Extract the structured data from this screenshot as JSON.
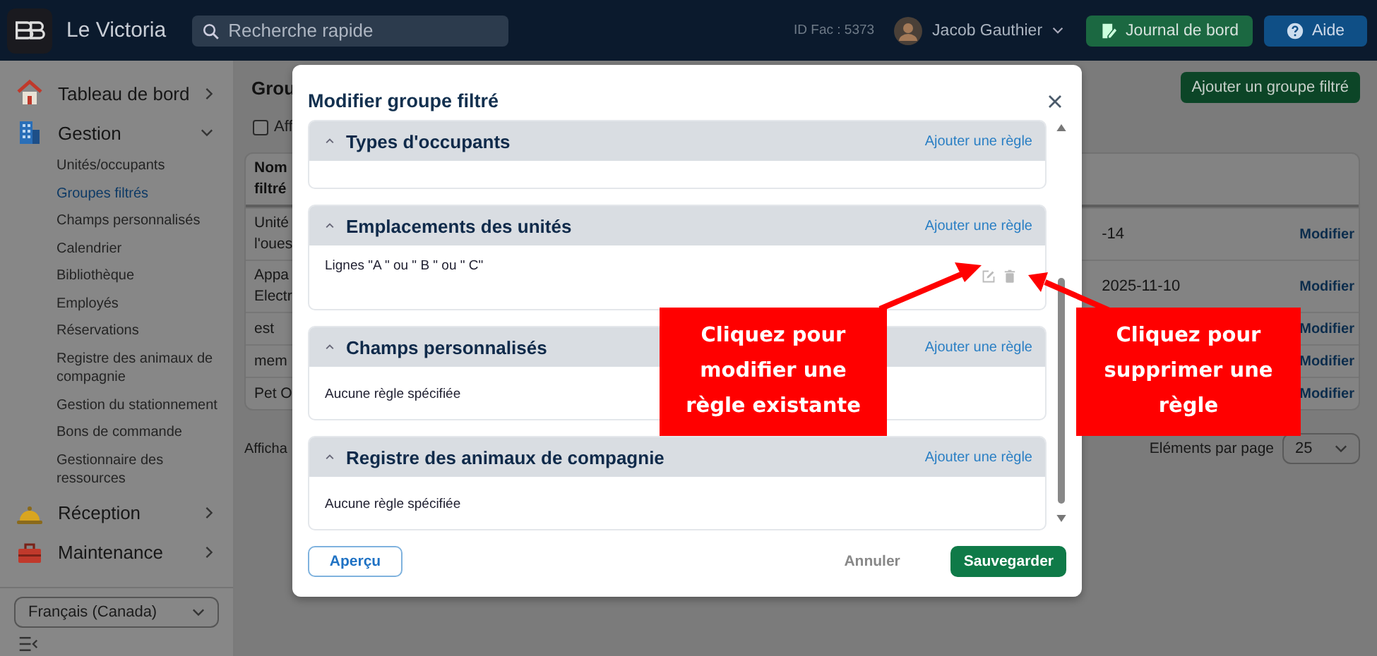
{
  "topbar": {
    "brand": "Le Victoria",
    "search": {
      "placeholder": "Recherche rapide"
    },
    "facility_id": "ID Fac : 5373",
    "user": "Jacob Gauthier",
    "buttons": [
      {
        "kind": "journal",
        "label": "Journal de bord"
      },
      {
        "kind": "help",
        "label": "Aide"
      }
    ]
  },
  "sidebar": {
    "items": [
      {
        "kind": "home",
        "label": "Tableau de bord",
        "expanded": false
      },
      {
        "kind": "building",
        "label": "Gestion",
        "expanded": true,
        "children": [
          {
            "label": "Unités/occupants",
            "selected": false
          },
          {
            "label": "Groupes filtrés",
            "selected": true
          },
          {
            "label": "Champs personnalisés",
            "selected": false
          },
          {
            "label": "Calendrier",
            "selected": false
          },
          {
            "label": "Bibliothèque",
            "selected": false
          },
          {
            "label": "Employés",
            "selected": false
          },
          {
            "label": "Réservations",
            "selected": false
          },
          {
            "label": "Registre des animaux de compagnie",
            "selected": false
          },
          {
            "label": "Gestion du stationnement",
            "selected": false
          },
          {
            "label": "Bons de commande",
            "selected": false
          },
          {
            "label": "Gestionnaire des ressources",
            "selected": false
          }
        ]
      },
      {
        "kind": "bell",
        "label": "Réception",
        "expanded": false
      },
      {
        "kind": "toolbox",
        "label": "Maintenance",
        "expanded": false
      }
    ],
    "language": "Français (Canada)"
  },
  "page": {
    "title": "Grou",
    "add_button": "Ajouter un groupe filtré",
    "checkbox": {
      "label": "Aff",
      "checked": false
    },
    "table": {
      "column_1": "Nom filtré",
      "rows": [
        {
          "column_1": "Unité l'oues",
          "column_2": "-14",
          "action": "Modifier"
        },
        {
          "column_1": "Appa Electr",
          "column_2": "2025-11-10",
          "action": "Modifier"
        },
        {
          "column_1": "est",
          "action": "Modifier"
        },
        {
          "column_1": "mem",
          "action": "Modifier"
        },
        {
          "column_1": "Pet O",
          "action": "Modifier"
        }
      ]
    },
    "footer_text": "Afficha",
    "page_size_label": "Eléments par page",
    "page_size": "25"
  },
  "modal": {
    "title": "Modifier groupe filtré",
    "sections": [
      {
        "title": "Types d'occupants",
        "expanded": true,
        "add_link": "Ajouter une règle"
      },
      {
        "title": "Emplacements des unités",
        "expanded": true,
        "add_link": "Ajouter une règle",
        "rules": [
          {
            "text": "Lignes \"A \" ou \" B \" ou \" C\""
          }
        ]
      },
      {
        "title": "Champs personnalisés",
        "expanded": true,
        "add_link": "Ajouter une règle",
        "empty_text": "Aucune règle spécifiée"
      },
      {
        "title": "Registre des animaux de compagnie",
        "expanded": true,
        "add_link": "Ajouter une règle",
        "empty_text": "Aucune règle spécifiée"
      }
    ],
    "preview_button": "Aperçu",
    "cancel_button": "Annuler",
    "save_button": "Sauvegarder"
  },
  "callouts": [
    {
      "text": "Cliquez pour modifier une règle existante"
    },
    {
      "text": "Cliquez pour supprimer une règle"
    }
  ]
}
